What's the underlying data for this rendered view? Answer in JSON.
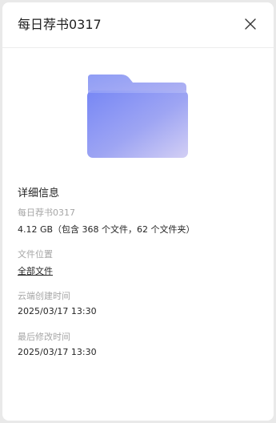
{
  "dialog": {
    "title": "每日荐书0317",
    "close_icon": "close-icon"
  },
  "folder": {
    "icon": "folder-icon",
    "colors": {
      "front_start": "#7b8bf6",
      "front_end": "#c9c6f3",
      "back": "#8f9bf2"
    }
  },
  "details": {
    "section_title": "详细信息",
    "name_label": "每日荐书0317",
    "size_value": "4.12 GB（包含 368 个文件，62 个文件夹）",
    "location_label": "文件位置",
    "location_value": "全部文件",
    "created_label": "云端创建时间",
    "created_value": "2025/03/17 13:30",
    "modified_label": "最后修改时间",
    "modified_value": "2025/03/17 13:30"
  }
}
